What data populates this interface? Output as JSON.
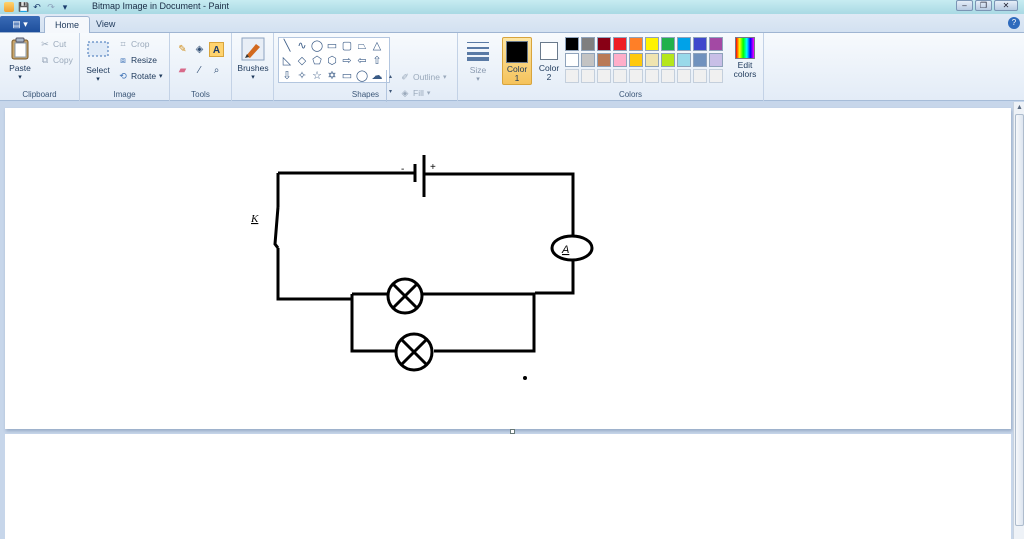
{
  "window": {
    "title": "Bitmap Image in Document - Paint",
    "controls": {
      "minimize": "–",
      "restore": "❐",
      "close": "✕"
    }
  },
  "quick_access": {
    "save": "💾",
    "undo": "↶",
    "redo": "↷",
    "customize": "▾"
  },
  "tabs": {
    "app_menu": "▤ ▾",
    "home": "Home",
    "view": "View",
    "help": "?"
  },
  "ribbon": {
    "clipboard": {
      "label": "Clipboard",
      "paste": "Paste",
      "cut": "Cut",
      "copy": "Copy"
    },
    "image": {
      "label": "Image",
      "select": "Select",
      "crop": "Crop",
      "resize": "Resize",
      "rotate": "Rotate"
    },
    "tools": {
      "label": "Tools"
    },
    "brushes": {
      "label": "Brushes"
    },
    "shapes": {
      "label": "Shapes",
      "outline": "Outline",
      "fill": "Fill"
    },
    "size": {
      "label": "Size"
    },
    "colors": {
      "label": "Colors",
      "color1": "Color",
      "color1_num": "1",
      "color2": "Color",
      "color2_num": "2",
      "color1_value": "#000000",
      "color2_value": "#ffffff",
      "edit_colors": "Edit colors",
      "palette_row1": [
        "#000000",
        "#7f7f7f",
        "#880015",
        "#ed1c24",
        "#ff7f27",
        "#fff200",
        "#22b14c",
        "#00a2e8",
        "#3f48cc",
        "#a349a4"
      ],
      "palette_row2": [
        "#ffffff",
        "#c3c3c3",
        "#b97a57",
        "#ffaec9",
        "#ffc90e",
        "#efe4b0",
        "#b5e61d",
        "#99d9ea",
        "#7092be",
        "#c8bfe7"
      ],
      "palette_row3": [
        "#f0f0f0",
        "#f0f0f0",
        "#f0f0f0",
        "#f0f0f0",
        "#f0f0f0",
        "#f0f0f0",
        "#f0f0f0",
        "#f0f0f0",
        "#f0f0f0",
        "#f0f0f0"
      ]
    }
  },
  "drawing": {
    "battery_minus": "-",
    "battery_plus": "+",
    "switch_label": "K",
    "ammeter_label": "A"
  }
}
